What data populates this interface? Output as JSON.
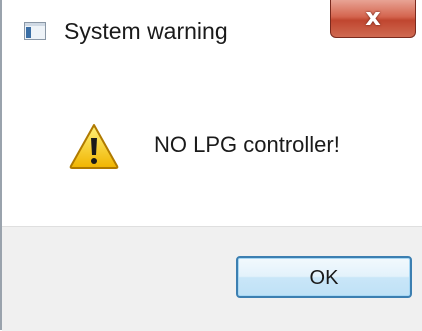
{
  "window": {
    "title": "System warning",
    "close_glyph": "x",
    "icon": "app-window-icon"
  },
  "content": {
    "message": "NO LPG controller!",
    "icon": "warning-icon"
  },
  "footer": {
    "ok_label": "OK"
  },
  "colors": {
    "accent": "#3c7fb1",
    "close_button": "#c0462f",
    "footer_background": "#f0f0f0",
    "warning_yellow": "#f5c518"
  }
}
